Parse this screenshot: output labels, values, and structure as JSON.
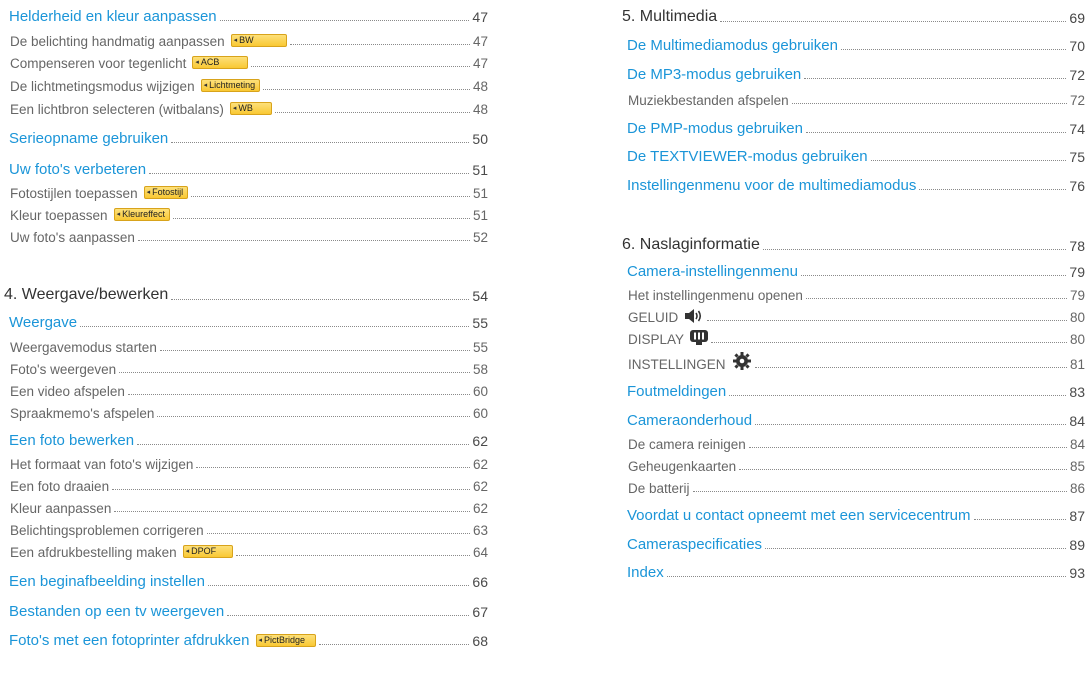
{
  "left": {
    "helderheid": {
      "label": "Helderheid en kleur aanpassen",
      "page": "47"
    },
    "belichting": {
      "label": "De belichting handmatig aanpassen",
      "badge": "BW",
      "page": "47"
    },
    "tegenlicht": {
      "label": "Compenseren voor tegenlicht",
      "badge": "ACB",
      "page": "47"
    },
    "lichtmeting": {
      "label": "De lichtmetingsmodus wijzigen",
      "badge": "Lichtmeting",
      "page": "48"
    },
    "witbalans": {
      "label": "Een lichtbron selecteren (witbalans)",
      "badge": "WB",
      "page": "48"
    },
    "serie": {
      "label": "Serieopname gebruiken",
      "page": "50"
    },
    "verbeteren": {
      "label": "Uw foto's verbeteren",
      "page": "51"
    },
    "fotostijlen": {
      "label": "Fotostijlen toepassen",
      "badge": "Fotostijl",
      "page": "51"
    },
    "kleur": {
      "label": "Kleur toepassen",
      "badge": "Kleureffect",
      "page": "51"
    },
    "aanpassen": {
      "label": "Uw foto's aanpassen",
      "page": "52"
    },
    "ch4": {
      "label": "4. Weergave/bewerken",
      "page": "54"
    },
    "weergave": {
      "label": "Weergave",
      "page": "55"
    },
    "weergavemodus": {
      "label": "Weergavemodus starten",
      "page": "55"
    },
    "fotos_weergeven": {
      "label": "Foto's weergeven",
      "page": "58"
    },
    "video": {
      "label": "Een video afspelen",
      "page": "60"
    },
    "spraak": {
      "label": "Spraakmemo's afspelen",
      "page": "60"
    },
    "bewerken": {
      "label": "Een foto bewerken",
      "page": "62"
    },
    "formaat": {
      "label": "Het formaat van foto's wijzigen",
      "page": "62"
    },
    "draaien": {
      "label": "Een foto draaien",
      "page": "62"
    },
    "kleur_aanpassen": {
      "label": "Kleur aanpassen",
      "page": "62"
    },
    "belichtingsproblemen": {
      "label": "Belichtingsproblemen corrigeren",
      "page": "63"
    },
    "afdruk": {
      "label": "Een afdrukbestelling maken",
      "badge": "DPOF",
      "page": "64"
    },
    "beginafbeelding": {
      "label": "Een beginafbeelding instellen",
      "page": "66"
    },
    "tv": {
      "label": "Bestanden op een tv weergeven",
      "page": "67"
    },
    "fotoprinter": {
      "label": "Foto's met een fotoprinter afdrukken",
      "badge": "PictBridge",
      "page": "68"
    }
  },
  "right": {
    "ch5": {
      "label": "5. Multimedia",
      "page": "69"
    },
    "multimediamodus": {
      "label": "De Multimediamodus gebruiken",
      "page": "70"
    },
    "mp3": {
      "label": "De MP3-modus gebruiken",
      "page": "72"
    },
    "muziek": {
      "label": "Muziekbestanden afspelen",
      "page": "72"
    },
    "pmp": {
      "label": "De PMP-modus gebruiken",
      "page": "74"
    },
    "textviewer": {
      "label": "De TEXTVIEWER-modus gebruiken",
      "page": "75"
    },
    "instellingenmenu_mm": {
      "label": "Instellingenmenu voor de multimediamodus",
      "page": "76"
    },
    "ch6": {
      "label": "6. Naslaginformatie",
      "page": "78"
    },
    "camera_menu": {
      "label": "Camera-instellingenmenu",
      "page": "79"
    },
    "menu_openen": {
      "label": "Het instellingenmenu openen",
      "page": "79"
    },
    "geluid": {
      "label": "GELUID",
      "icon": "speaker-icon",
      "page": "80"
    },
    "display": {
      "label": "DISPLAY",
      "icon": "display-icon",
      "page": "80"
    },
    "instellingen": {
      "label": "INSTELLINGEN",
      "icon": "gear-icon",
      "page": "81"
    },
    "foutmeldingen": {
      "label": "Foutmeldingen",
      "page": "83"
    },
    "onderhoud": {
      "label": "Cameraonderhoud",
      "page": "84"
    },
    "reinigen": {
      "label": "De camera reinigen",
      "page": "84"
    },
    "geheugenkaarten": {
      "label": "Geheugenkaarten",
      "page": "85"
    },
    "batterij": {
      "label": "De batterij",
      "page": "86"
    },
    "servicecentrum": {
      "label": "Voordat u contact opneemt met een servicecentrum",
      "page": "87"
    },
    "specificaties": {
      "label": "Cameraspecificaties",
      "page": "89"
    },
    "index": {
      "label": "Index",
      "page": "93"
    }
  },
  "colors": {
    "section": "#1b95d8",
    "badge": "#f9c833",
    "text": "#4a4a4a"
  }
}
